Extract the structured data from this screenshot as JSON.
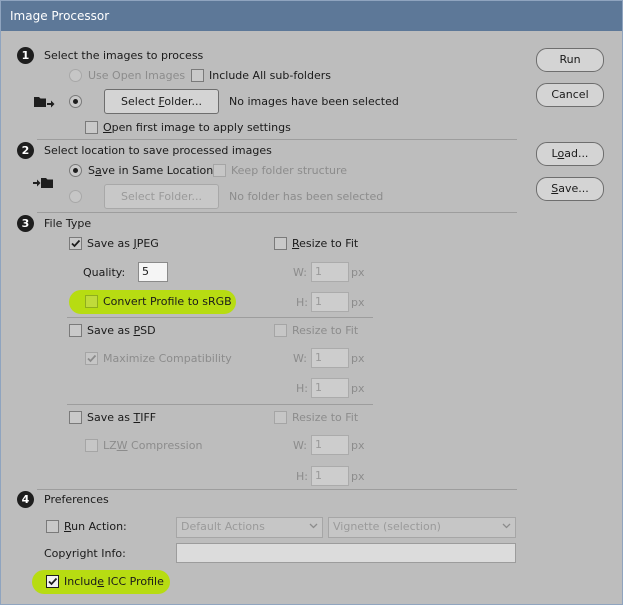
{
  "window": {
    "title": "Image Processor"
  },
  "buttons": {
    "run": "Run",
    "cancel": "Cancel",
    "load_pre": "L",
    "load_u": "o",
    "load_post": "ad...",
    "save_pre": "",
    "save_u": "S",
    "save_post": "ave..."
  },
  "section1": {
    "number": "1",
    "title": "Select the images to process",
    "use_open_images": "Use Open Images",
    "include_subfolders": "Include All sub-folders",
    "select_folder_pre": "Select ",
    "select_folder_u": "F",
    "select_folder_post": "older...",
    "status": "No images have been selected",
    "open_first_pre": "",
    "open_first_u": "O",
    "open_first_post": "pen first image to apply settings"
  },
  "section2": {
    "number": "2",
    "title": "Select location to save processed images",
    "save_same_pre": "S",
    "save_same_u": "a",
    "save_same_post": "ve in Same Location",
    "keep_structure": "Keep folder structure",
    "select_folder": "Select Folder...",
    "status": "No folder has been selected"
  },
  "section3": {
    "number": "3",
    "title": "File Type",
    "jpeg_pre": "Save as ",
    "jpeg_u": "J",
    "jpeg_post": "PEG",
    "resize_pre": "",
    "resize_u": "R",
    "resize_post": "esize to Fit",
    "quality_label": "Quality:",
    "quality_value": "5",
    "w_label": "W:",
    "h_label": "H:",
    "size_value": "1",
    "px": "px",
    "convert_profile": "Convert Profile to sRGB",
    "psd_pre": "Save as ",
    "psd_u": "P",
    "psd_post": "SD",
    "resize_fit": "Resize to Fit",
    "maximize": "Maximize Compatibility",
    "tiff_pre": "Save as ",
    "tiff_u": "T",
    "tiff_post": "IFF",
    "lzw_pre": "LZ",
    "lzw_u": "W",
    "lzw_post": " Compression"
  },
  "section4": {
    "number": "4",
    "title": "Preferences",
    "run_action_pre": "",
    "run_action_u": "R",
    "run_action_post": "un Action:",
    "action_set": "Default Actions",
    "action": "Vignette (selection)",
    "copyright_label": "Copyright Info:",
    "copyright_value": "",
    "icc_pre": "Includ",
    "icc_u": "e",
    "icc_post": " ICC Profile"
  },
  "colors": {
    "titlebar": "#5d7898",
    "dialog_bg": "#bdbdbd",
    "highlight": "#b7dc12"
  },
  "icons": {
    "source": "folder-arrow-right-icon",
    "destination": "arrow-into-folder-icon"
  }
}
